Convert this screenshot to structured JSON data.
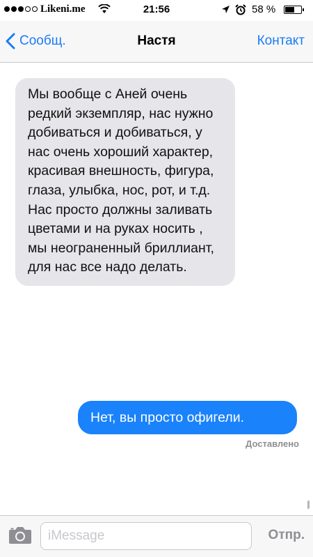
{
  "status_bar": {
    "carrier": "Likeni.me",
    "signal_bars_filled": 3,
    "signal_bars_total": 5,
    "time": "21:56",
    "battery_percent": "58 %",
    "battery_level": 0.58,
    "icons": [
      "wifi-icon",
      "location-arrow-icon",
      "alarm-icon",
      "battery-icon"
    ]
  },
  "nav": {
    "back_label": "Сообщ.",
    "title": "Настя",
    "contact_label": "Контакт"
  },
  "messages": [
    {
      "direction": "incoming",
      "text": "Мы вообще с Аней очень редкий экземпляр, нас нужно добиваться и добиваться, у нас очень хороший характер, красивая внешность, фигура, глаза, улыбка, нос, рот, и т.д. Нас просто должны заливать цветами и на руках носить , мы неограненный бриллиант, для нас все надо делать."
    },
    {
      "direction": "outgoing",
      "text": "Нет, вы просто офигели."
    }
  ],
  "delivery_status": "Доставлено",
  "composer": {
    "placeholder": "iMessage",
    "value": "",
    "send_label": "Отпр."
  },
  "colors": {
    "accent": "#1a7cf5",
    "outgoing_bubble": "#1a82fb",
    "incoming_bubble": "#e5e5ea",
    "bar_background": "#f7f7f8",
    "muted_text": "#8e8e93"
  }
}
